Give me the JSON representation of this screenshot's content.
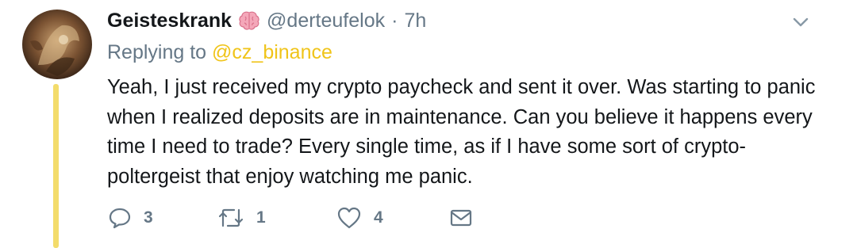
{
  "tweet": {
    "display_name": "Geisteskrank",
    "name_emoji": "brain-emoji",
    "handle": "@derteufelok",
    "separator": "·",
    "time": "7h",
    "reply_prefix": "Replying to",
    "reply_mention": "@cz_binance",
    "body_lines": [
      "Yeah, I just received my crypto paycheck and sent it over. Was starting to panic",
      "when I realized deposits are in maintenance. Can you believe it happens every",
      "time I need to trade? Every single time, as if I have some sort of crypto-",
      "poltergeist that enjoy watching me panic."
    ],
    "actions": {
      "reply_count": "3",
      "retweet_count": "1",
      "like_count": "4"
    },
    "icons": {
      "reply": "reply-icon",
      "retweet": "retweet-icon",
      "like": "heart-icon",
      "dm": "envelope-icon",
      "menu": "chevron-down-icon"
    },
    "colors": {
      "mention": "#f0c419",
      "thread_line": "#f3dc6b",
      "secondary_text": "#657786"
    }
  }
}
